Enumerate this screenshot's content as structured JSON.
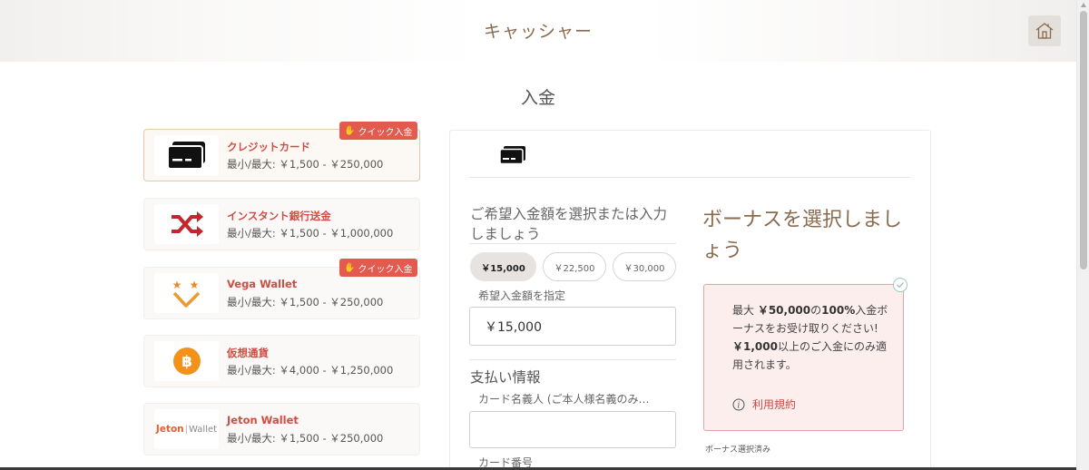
{
  "header": {
    "title": "キャッシャー"
  },
  "section": {
    "title": "入金"
  },
  "methods": [
    {
      "name": "クレジットカード",
      "range": "最小/最大: ￥1,500 - ￥250,000",
      "badge": "クイック入金"
    },
    {
      "name": "インスタント銀行送金",
      "range": "最小/最大: ￥1,500 - ￥1,000,000"
    },
    {
      "name": "Vega Wallet",
      "range": "最小/最大: ￥1,500 - ￥250,000",
      "badge": "クイック入金"
    },
    {
      "name": "仮想通貨",
      "range": "最小/最大: ￥4,000 - ￥1,250,000"
    },
    {
      "name": "Jeton Wallet",
      "range": "最小/最大: ￥1,500 - ￥250,000",
      "logo_text_a": "Jeton",
      "logo_text_b": "Wallet"
    }
  ],
  "deposit": {
    "heading": "ご希望入金額を選択または入力しましょう",
    "amount_options": [
      "￥15,000",
      "￥22,500",
      "￥30,000"
    ],
    "custom_label": "希望入金額を指定",
    "amount_value": "￥15,000"
  },
  "payment": {
    "heading": "支払い情報",
    "cardholder_label": "カード名義人 (ご本人様名義のみ…",
    "card_number_label": "カード番号"
  },
  "bonus": {
    "heading": "ボーナスを選択しましょう",
    "line1_prefix": "最大 ",
    "line1_amount": "￥50,000",
    "line1_mid": "の",
    "line1_percent": "100%",
    "line1_suffix": "入金ボーナスをお受け取りください!",
    "line2_amount": "￥1,000",
    "line2_suffix": "以上のご入金にのみ適用されます。",
    "terms": "利用規約",
    "selected_label": "ボーナス選択済み"
  },
  "colors": {
    "accent": "#d24c43",
    "brand_brown": "#8b6b4e",
    "badge": "#e35a4f"
  }
}
